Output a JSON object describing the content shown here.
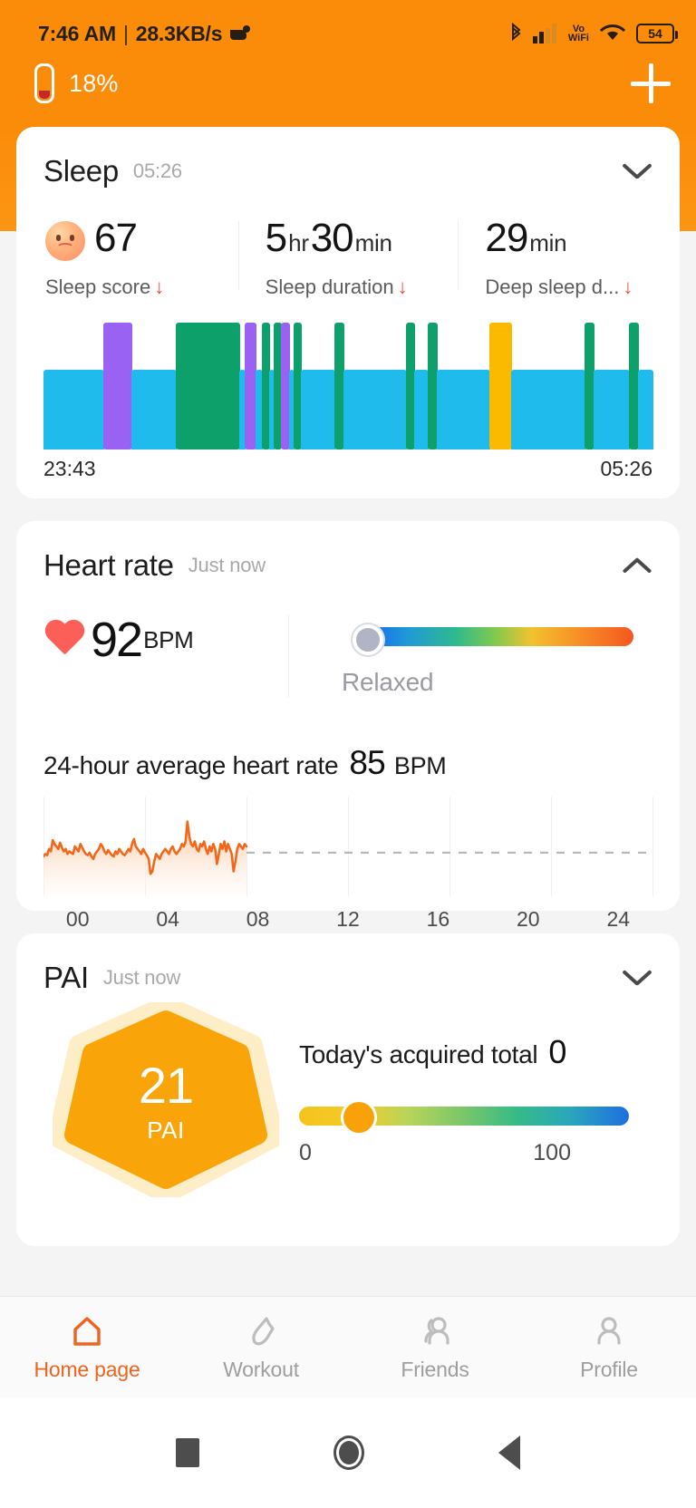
{
  "statusbar": {
    "time": "7:46 AM",
    "separator": "|",
    "network_speed": "28.3KB/s",
    "battery_level": "54",
    "vo_label": "Vo",
    "wifi_label": "WiFi"
  },
  "device": {
    "battery_percent": "18%",
    "add_label": "+"
  },
  "sleep": {
    "title": "Sleep",
    "time": "05:26",
    "stats": [
      {
        "value": "67",
        "unit": "",
        "label": "Sleep score",
        "trend": "↓",
        "has_face": true
      },
      {
        "value": "5",
        "unit": "hr",
        "value2": "30",
        "unit2": "min",
        "label": "Sleep duration",
        "trend": "↓"
      },
      {
        "value": "29",
        "unit": "min",
        "label": "Deep sleep d...",
        "trend": "↓"
      }
    ],
    "axis_start": "23:43",
    "axis_end": "05:26",
    "chart_data": {
      "type": "bar",
      "title": "Sleep stages",
      "xlabel": "",
      "ylabel": "",
      "x_range": [
        "23:43",
        "05:26"
      ],
      "legend": [
        "light",
        "deep",
        "rem",
        "awake"
      ],
      "colors": {
        "light": "#1fbbed",
        "deep": "#0da06a",
        "rem": "#9a62f2",
        "awake": "#fbba00"
      },
      "base_height_pct": 63,
      "segments": [
        {
          "stage": "light",
          "start_pct": 0.0,
          "width_pct": 9.8,
          "height_pct": 63
        },
        {
          "stage": "rem",
          "start_pct": 9.8,
          "width_pct": 4.6,
          "height_pct": 100
        },
        {
          "stage": "light",
          "start_pct": 14.4,
          "width_pct": 7.3,
          "height_pct": 63
        },
        {
          "stage": "deep",
          "start_pct": 21.7,
          "width_pct": 10.5,
          "height_pct": 100
        },
        {
          "stage": "light",
          "start_pct": 32.2,
          "width_pct": 0.9,
          "height_pct": 63
        },
        {
          "stage": "rem",
          "start_pct": 33.1,
          "width_pct": 1.7,
          "height_pct": 100
        },
        {
          "stage": "light",
          "start_pct": 34.8,
          "width_pct": 1.1,
          "height_pct": 63
        },
        {
          "stage": "deep",
          "start_pct": 35.9,
          "width_pct": 1.2,
          "height_pct": 100
        },
        {
          "stage": "light",
          "start_pct": 37.1,
          "width_pct": 0.7,
          "height_pct": 63
        },
        {
          "stage": "deep",
          "start_pct": 37.8,
          "width_pct": 1.2,
          "height_pct": 100
        },
        {
          "stage": "rem",
          "start_pct": 39.0,
          "width_pct": 1.4,
          "height_pct": 100
        },
        {
          "stage": "light",
          "start_pct": 40.4,
          "width_pct": 0.6,
          "height_pct": 63
        },
        {
          "stage": "deep",
          "start_pct": 41.0,
          "width_pct": 1.3,
          "height_pct": 100
        },
        {
          "stage": "light",
          "start_pct": 42.3,
          "width_pct": 5.4,
          "height_pct": 63
        },
        {
          "stage": "deep",
          "start_pct": 47.7,
          "width_pct": 1.5,
          "height_pct": 100
        },
        {
          "stage": "light",
          "start_pct": 49.2,
          "width_pct": 10.3,
          "height_pct": 63
        },
        {
          "stage": "deep",
          "start_pct": 59.5,
          "width_pct": 1.4,
          "height_pct": 100
        },
        {
          "stage": "light",
          "start_pct": 60.9,
          "width_pct": 2.2,
          "height_pct": 63
        },
        {
          "stage": "deep",
          "start_pct": 63.1,
          "width_pct": 1.5,
          "height_pct": 100
        },
        {
          "stage": "light",
          "start_pct": 64.6,
          "width_pct": 8.6,
          "height_pct": 63
        },
        {
          "stage": "awake",
          "start_pct": 73.2,
          "width_pct": 3.6,
          "height_pct": 100
        },
        {
          "stage": "light",
          "start_pct": 76.8,
          "width_pct": 12.1,
          "height_pct": 63
        },
        {
          "stage": "deep",
          "start_pct": 88.9,
          "width_pct": 1.4,
          "height_pct": 100
        },
        {
          "stage": "light",
          "start_pct": 90.3,
          "width_pct": 5.9,
          "height_pct": 63
        },
        {
          "stage": "deep",
          "start_pct": 96.2,
          "width_pct": 1.4,
          "height_pct": 100
        },
        {
          "stage": "light",
          "start_pct": 97.6,
          "width_pct": 2.4,
          "height_pct": 63
        }
      ]
    }
  },
  "heart_rate": {
    "title": "Heart rate",
    "time": "Just now",
    "current_value": "92",
    "current_unit": "BPM",
    "state": "Relaxed",
    "gauge_position_pct": 0,
    "avg_title": "24-hour average heart rate",
    "avg_value": "85",
    "avg_unit": "BPM",
    "chart_data": {
      "type": "line",
      "title": "24-hour average heart rate",
      "xlabel": "",
      "ylabel": "BPM",
      "tick_labels": [
        "00",
        "04",
        "08",
        "12",
        "16",
        "20",
        "24"
      ],
      "xlim": [
        0,
        24
      ],
      "ylim": [
        50,
        130
      ],
      "avg_line": 85,
      "data_end_hour": 8,
      "color": "#f2681a",
      "values": [
        82,
        84,
        83,
        88,
        86,
        95,
        92,
        90,
        88,
        93,
        89,
        86,
        88,
        84,
        86,
        85,
        84,
        90,
        88,
        86,
        92,
        89,
        86,
        84,
        83,
        85,
        82,
        80,
        84,
        86,
        88,
        92,
        90,
        86,
        84,
        87,
        85,
        83,
        82,
        86,
        84,
        88,
        86,
        84,
        83,
        85,
        88,
        86,
        92,
        96,
        90,
        88,
        86,
        84,
        88,
        85,
        83,
        80,
        68,
        70,
        78,
        84,
        82,
        80,
        84,
        86,
        88,
        86,
        84,
        88,
        90,
        86,
        84,
        86,
        88,
        92,
        90,
        94,
        110,
        98,
        92,
        90,
        94,
        88,
        86,
        92,
        90,
        94,
        88,
        84,
        90,
        86,
        92,
        88,
        76,
        84,
        92,
        88,
        94,
        86,
        92,
        88,
        84,
        70,
        78,
        88,
        92,
        90,
        88,
        92,
        90
      ]
    }
  },
  "pai": {
    "title": "PAI",
    "time": "Just now",
    "score": "21",
    "score_label": "PAI",
    "total_label": "Today's acquired total",
    "total_value": "0",
    "slider_min": "0",
    "slider_max": "100",
    "slider_position_pct": 18,
    "colors": {
      "heptagon": "#f9a50a",
      "halo": "#fdeec8"
    }
  },
  "nav": {
    "items": [
      {
        "label": "Home page",
        "icon": "home-icon",
        "active": true
      },
      {
        "label": "Workout",
        "icon": "shoe-icon",
        "active": false
      },
      {
        "label": "Friends",
        "icon": "friends-icon",
        "active": false
      },
      {
        "label": "Profile",
        "icon": "person-icon",
        "active": false
      }
    ],
    "accent": "#f0631e"
  },
  "system_nav": {
    "recent": "square",
    "home": "circle",
    "back": "triangle"
  }
}
